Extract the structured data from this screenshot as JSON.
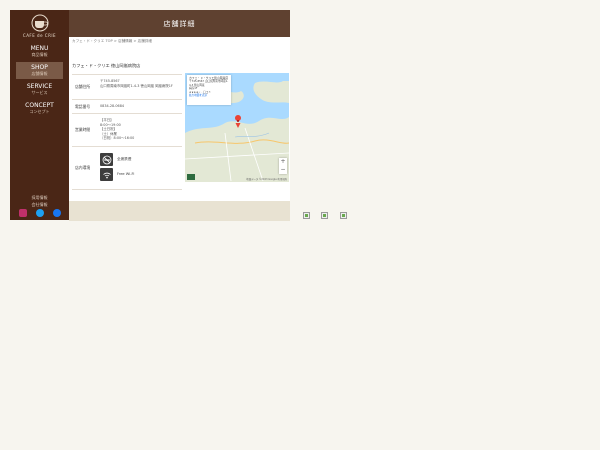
{
  "brand": {
    "logo_text": "CAFE de CRIE"
  },
  "nav": [
    {
      "en": "MENU",
      "ja": "商品情報",
      "active": false
    },
    {
      "en": "SHOP",
      "ja": "店舗情報",
      "active": true
    },
    {
      "en": "SERVICE",
      "ja": "サービス",
      "active": false
    },
    {
      "en": "CONCEPT",
      "ja": "コンセプト",
      "active": false
    }
  ],
  "side_links": [
    "採用情報",
    "会社情報"
  ],
  "social": [
    "instagram-icon",
    "twitter-icon",
    "facebook-icon"
  ],
  "header": {
    "title": "店舗詳細"
  },
  "breadcrumb": "カフェ・ド・クリエ TOP > 店舗情報 > 店舗詳細",
  "shop": {
    "name": "カフェ・ド・クリエ 徳山岡嵐病院店",
    "address_label": "店舗住所",
    "address_lines": [
      "〒745-8567",
      "山口県周南市岡嵐町1-4-3 徳山岡嵐 岡嵐病院1F"
    ],
    "phone_label": "電話番号",
    "phone": "0834-28-0684",
    "hours_label": "営業時間",
    "hours_lines": [
      "【平日】",
      "8:00～19:00",
      "【土日祝】",
      "（土）休業",
      "（日祝）8:00～16:00"
    ],
    "facility_label": "店内環境",
    "facilities": [
      {
        "icon": "no-smoking-icon",
        "label": "全席禁煙"
      },
      {
        "icon": "wifi-icon",
        "label": "Free Wi-Fi"
      }
    ]
  },
  "map": {
    "card_title": "カフェ・ド・クリエ徳山岡嵐店",
    "card_lines": [
      "〒745-8567 山口県周南市岡嵐1-4-3 徳山岡嵐",
      "病院1F"
    ],
    "card_rating": "★★★★☆ · 口コミ",
    "card_link": "拡大地図を表示",
    "zoom_in": "+",
    "zoom_out": "−",
    "footer": "地図データ ©2023 Google 利用規約"
  },
  "colors": {
    "sidebar": "#4a2616",
    "header": "#5f4130",
    "footer_band": "#e8e2d2",
    "page_bg": "#f7f5ef"
  }
}
